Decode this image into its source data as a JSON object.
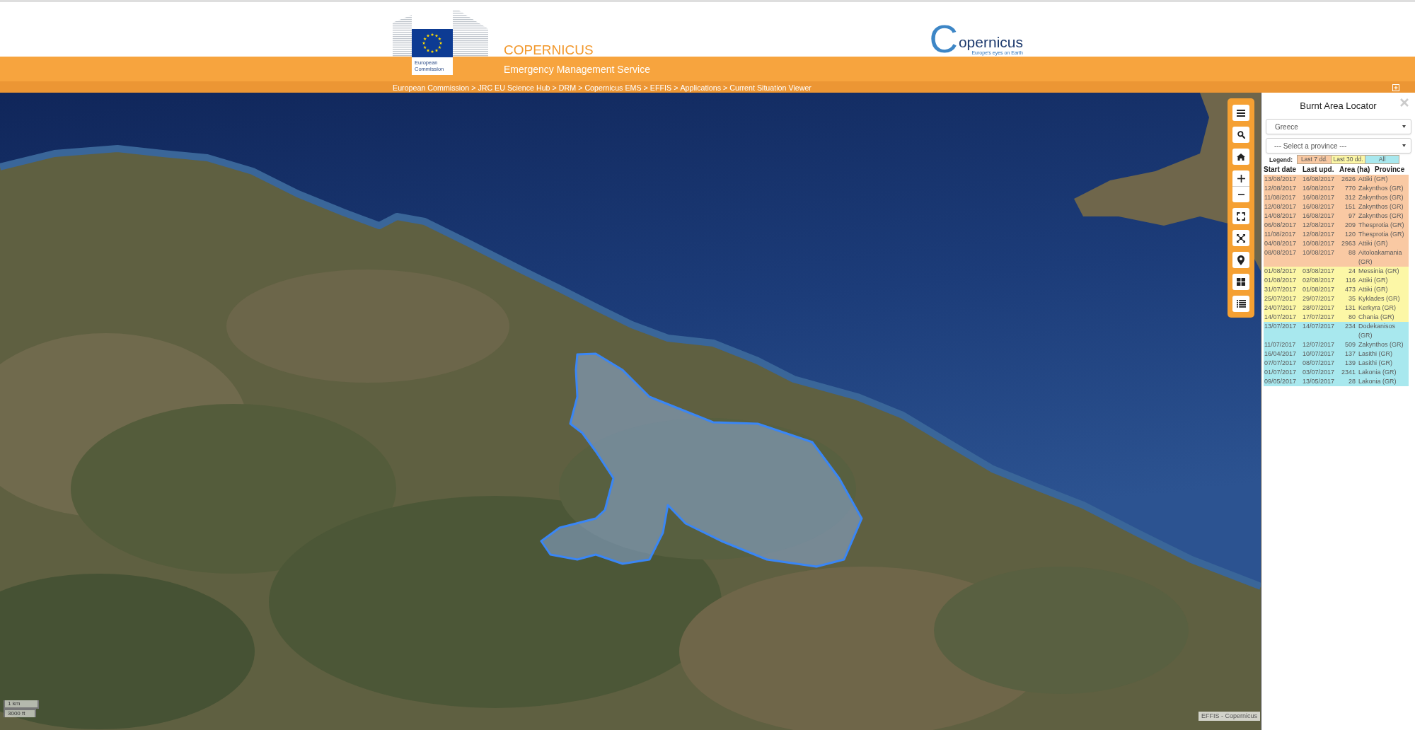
{
  "header": {
    "ec_logo": {
      "label": "European Commission"
    },
    "title": "COPERNICUS",
    "subtitle": "Emergency Management Service",
    "copernicus_logo": {
      "initial": "C",
      "name": "opernicus",
      "tagline": "Europe's eyes on Earth"
    }
  },
  "breadcrumb": {
    "separator": ">",
    "items": [
      "European Commission",
      "JRC EU Science Hub",
      "DRM",
      "Copernicus EMS",
      "EFFIS",
      "Applications",
      "Current Situation Viewer"
    ]
  },
  "map": {
    "scale_bar": {
      "metric": "1 km",
      "imperial": "3000 ft"
    },
    "attribution": "EFFIS - Copernicus"
  },
  "panel": {
    "title": "Burnt Area Locator",
    "country_select": {
      "value": "Greece"
    },
    "province_select": {
      "value": "--- Select a province ---"
    },
    "legend": {
      "label": "Legend:",
      "items": [
        {
          "label": "Last 7 dd.",
          "color": "#f9c9a3"
        },
        {
          "label": "Last 30 dd.",
          "color": "#fcf7a6"
        },
        {
          "label": "All",
          "color": "#a8e8ee"
        }
      ]
    },
    "table": {
      "columns": [
        "Start date",
        "Last upd.",
        "Area (ha)",
        "Province"
      ],
      "rows": [
        {
          "start_date": "13/08/2017",
          "last_update": "16/08/2017",
          "area": "2626",
          "province": "Attiki (GR)",
          "color": "#f9c9a3"
        },
        {
          "start_date": "12/08/2017",
          "last_update": "16/08/2017",
          "area": "770",
          "province": "Zakynthos (GR)",
          "color": "#f9c9a3"
        },
        {
          "start_date": "11/08/2017",
          "last_update": "16/08/2017",
          "area": "312",
          "province": "Zakynthos (GR)",
          "color": "#f9c9a3"
        },
        {
          "start_date": "12/08/2017",
          "last_update": "16/08/2017",
          "area": "151",
          "province": "Zakynthos (GR)",
          "color": "#f9c9a3"
        },
        {
          "start_date": "14/08/2017",
          "last_update": "16/08/2017",
          "area": "97",
          "province": "Zakynthos (GR)",
          "color": "#f9c9a3"
        },
        {
          "start_date": "06/08/2017",
          "last_update": "12/08/2017",
          "area": "209",
          "province": "Thesprotia (GR)",
          "color": "#f9c9a3"
        },
        {
          "start_date": "11/08/2017",
          "last_update": "12/08/2017",
          "area": "120",
          "province": "Thesprotia (GR)",
          "color": "#f9c9a3"
        },
        {
          "start_date": "04/08/2017",
          "last_update": "10/08/2017",
          "area": "2963",
          "province": "Attiki (GR)",
          "color": "#f9c9a3"
        },
        {
          "start_date": "08/08/2017",
          "last_update": "10/08/2017",
          "area": "88",
          "province": "Aitoloakamania (GR)",
          "color": "#f9c9a3"
        },
        {
          "start_date": "01/08/2017",
          "last_update": "03/08/2017",
          "area": "24",
          "province": "Messinia (GR)",
          "color": "#fcf7a6"
        },
        {
          "start_date": "01/08/2017",
          "last_update": "02/08/2017",
          "area": "116",
          "province": "Attiki (GR)",
          "color": "#fcf7a6"
        },
        {
          "start_date": "31/07/2017",
          "last_update": "01/08/2017",
          "area": "473",
          "province": "Attiki (GR)",
          "color": "#fcf7a6"
        },
        {
          "start_date": "25/07/2017",
          "last_update": "29/07/2017",
          "area": "35",
          "province": "Kyklades (GR)",
          "color": "#fcf7a6"
        },
        {
          "start_date": "24/07/2017",
          "last_update": "28/07/2017",
          "area": "131",
          "province": "Kerkyra (GR)",
          "color": "#fcf7a6"
        },
        {
          "start_date": "14/07/2017",
          "last_update": "17/07/2017",
          "area": "80",
          "province": "Chania (GR)",
          "color": "#fcf7a6"
        },
        {
          "start_date": "13/07/2017",
          "last_update": "14/07/2017",
          "area": "234",
          "province": "Dodekanisos (GR)",
          "color": "#a8e8ee"
        },
        {
          "start_date": "11/07/2017",
          "last_update": "12/07/2017",
          "area": "509",
          "province": "Zakynthos (GR)",
          "color": "#a8e8ee"
        },
        {
          "start_date": "16/04/2017",
          "last_update": "10/07/2017",
          "area": "137",
          "province": "Lasithi (GR)",
          "color": "#a8e8ee"
        },
        {
          "start_date": "07/07/2017",
          "last_update": "08/07/2017",
          "area": "139",
          "province": "Lasithi (GR)",
          "color": "#a8e8ee"
        },
        {
          "start_date": "01/07/2017",
          "last_update": "03/07/2017",
          "area": "2341",
          "province": "Lakonia (GR)",
          "color": "#a8e8ee"
        },
        {
          "start_date": "09/05/2017",
          "last_update": "13/05/2017",
          "area": "28",
          "province": "Lakonia (GR)",
          "color": "#a8e8ee"
        }
      ]
    }
  }
}
